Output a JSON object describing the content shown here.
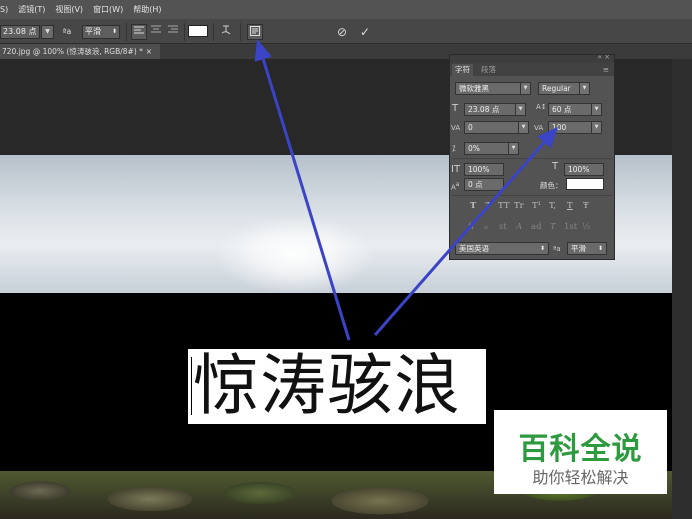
{
  "menu": {
    "items": [
      "S)",
      "滤镜(T)",
      "视图(V)",
      "窗口(W)",
      "帮助(H)"
    ]
  },
  "options_bar": {
    "font_size": "23.08 点",
    "aa_icon": "ªa",
    "anti_alias": "平滑",
    "align_left_icon": "align-left-icon",
    "align_center_icon": "align-center-icon",
    "align_right_icon": "align-right-icon",
    "color_swatch": "#ffffff",
    "warp_icon": "warp-text-icon",
    "panels_icon": "character-panel-icon",
    "cancel_icon": "⊘",
    "commit_icon": "✓"
  },
  "document_tab": {
    "title": "720.jpg @ 100% (惊涛骇浪, RGB/8#) *",
    "close": "×"
  },
  "canvas": {
    "text_layer": "惊涛骇浪"
  },
  "watermark": {
    "line1": "百科全说",
    "line2": "助你轻松解决"
  },
  "character_panel": {
    "controls": "«  ×",
    "menu_icon": "≡",
    "tabs": [
      "字符",
      "段落"
    ],
    "font_family": "微软雅黑",
    "font_style": "Regular",
    "size": "23.08 点",
    "leading": "60 点",
    "kerning": "0",
    "tracking": "100",
    "scale_pct": "0%",
    "vertical_scale": "100%",
    "horizontal_scale": "100%",
    "baseline_shift": "0 点",
    "color_label": "颜色：",
    "color_value": "#ffffff",
    "style_buttons": [
      "T",
      "T",
      "TT",
      "Tr",
      "T¹",
      "T,",
      "T",
      "Ŧ"
    ],
    "opentype_buttons": [
      "fi",
      "ℴ",
      "st",
      "A",
      "ad",
      "T",
      "1st",
      "½"
    ],
    "language": "美国英语",
    "aa_icon": "ªa",
    "aa_method": "平滑"
  },
  "colors": {
    "arrow": "#3b44c6",
    "watermark_green": "#2e9a3f",
    "panel_bg": "#535353"
  }
}
